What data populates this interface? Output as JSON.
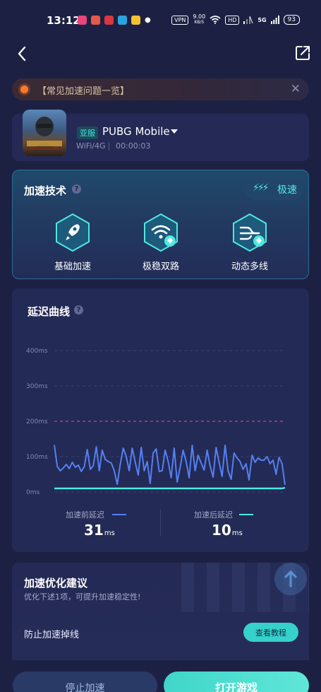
{
  "status_bar": {
    "time": "13:12",
    "vpn": "VPN",
    "speed": "9.00",
    "speed_unit": "KB/S",
    "signal": "5G",
    "hd": "HD",
    "battery": "93"
  },
  "faq": {
    "text": "【常见加速问题一览】"
  },
  "game": {
    "region": "亚服",
    "name": "PUBG Mobile",
    "network": "WiFi/4G",
    "elapsed": "00:00:03"
  },
  "tech": {
    "title": "加速技术",
    "badge": "极速",
    "features": [
      {
        "label": "基础加速",
        "icon": "rocket-icon"
      },
      {
        "label": "极稳双路",
        "icon": "wifi-dual-icon"
      },
      {
        "label": "动态多线",
        "icon": "multiline-icon"
      }
    ]
  },
  "latency": {
    "title": "延迟曲线",
    "legend_before": "加速前延迟",
    "legend_after": "加速后延迟",
    "before_value": "31",
    "after_value": "10",
    "unit": "ms"
  },
  "chart_data": {
    "type": "line",
    "ylim": [
      0,
      400
    ],
    "yticks": [
      "0ms",
      "100ms",
      "200ms",
      "300ms",
      "400ms"
    ],
    "threshold": 200,
    "series": [
      {
        "name": "加速前延迟",
        "color": "#5580f0",
        "values": [
          133,
          72,
          60,
          68,
          78,
          66,
          84,
          70,
          76,
          58,
          72,
          120,
          64,
          74,
          128,
          60,
          118,
          92,
          86,
          82,
          60,
          22,
          78,
          124,
          100,
          60,
          124,
          84,
          48,
          126,
          60,
          86,
          24,
          110,
          122,
          58,
          60,
          118,
          86,
          40,
          124,
          28,
          70,
          118,
          86,
          40,
          132,
          60,
          104,
          82,
          62,
          118,
          74,
          42,
          126,
          84,
          44,
          132,
          60,
          36,
          110,
          96,
          86,
          64,
          80,
          34,
          104,
          84,
          96,
          90,
          90,
          100,
          80,
          90,
          50,
          98,
          80,
          20
        ]
      },
      {
        "name": "加速后延迟",
        "color": "#4fe8e0",
        "values": [
          10,
          10,
          10,
          10,
          10,
          10,
          10,
          10,
          10,
          10,
          10,
          10,
          10,
          10,
          10,
          10,
          10,
          10,
          10,
          10,
          10,
          10,
          10,
          10,
          10,
          10,
          10,
          10,
          10,
          10,
          10,
          10,
          10,
          10,
          10,
          10,
          10,
          10,
          10,
          10,
          10,
          10,
          10,
          10,
          10,
          10,
          10,
          10,
          10,
          10,
          10,
          10,
          10,
          10,
          10,
          10,
          10,
          10,
          10,
          10,
          10,
          10,
          10,
          10,
          10,
          10,
          10,
          10,
          10,
          10,
          10,
          10,
          10,
          10,
          10,
          10,
          10,
          12
        ]
      }
    ]
  },
  "suggestion": {
    "title": "加速优化建议",
    "subtitle": "优化下述1项，可提升加速稳定性!",
    "item": "防止加速掉线",
    "button": "查看教程"
  },
  "actions": {
    "stop": "停止加速",
    "open": "打开游戏"
  },
  "colors": {
    "accent": "#4fe8e0",
    "background": "#1c2144",
    "card": "#232a55",
    "before_line": "#5580f0",
    "threshold_line": "#e0587a"
  }
}
